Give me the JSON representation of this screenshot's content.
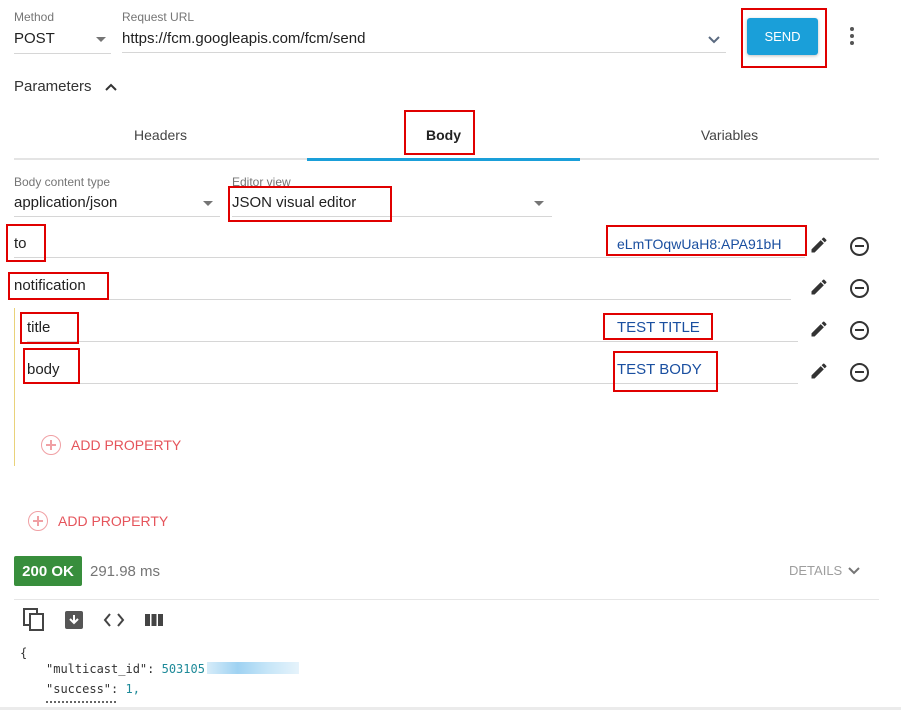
{
  "request": {
    "method_label": "Method",
    "method": "POST",
    "url_label": "Request URL",
    "url": "https://fcm.googleapis.com/fcm/send",
    "send_label": "SEND"
  },
  "parameters": {
    "title": "Parameters",
    "tabs": [
      {
        "label": "Headers"
      },
      {
        "label": "Body",
        "active": true
      },
      {
        "label": "Variables"
      }
    ]
  },
  "body": {
    "content_type_label": "Body content type",
    "content_type": "application/json",
    "editor_view_label": "Editor view",
    "editor_view": "JSON visual editor",
    "rows": [
      {
        "name": "to",
        "value": "eLmTOqwUaH8:APA91bH"
      },
      {
        "name": "notification",
        "value": ""
      },
      {
        "name": "title",
        "value": "TEST TITLE"
      },
      {
        "name": "body",
        "value": "TEST BODY"
      }
    ],
    "add_property_nested": "ADD PROPERTY",
    "add_property": "ADD PROPERTY"
  },
  "response": {
    "status": "200 OK",
    "status_color": "#388e3c",
    "time": "291.98 ms",
    "details_label": "DETAILS",
    "json": {
      "open_brace": "{",
      "multicast_key": "\"multicast_id\"",
      "multicast_value": "503105",
      "success_key": "\"success\"",
      "success_value": "1,"
    }
  },
  "colors": {
    "accent": "#1a9fd9",
    "highlight": "#e00000",
    "link": "#1a4fa0",
    "add_property": "#e5545b"
  }
}
